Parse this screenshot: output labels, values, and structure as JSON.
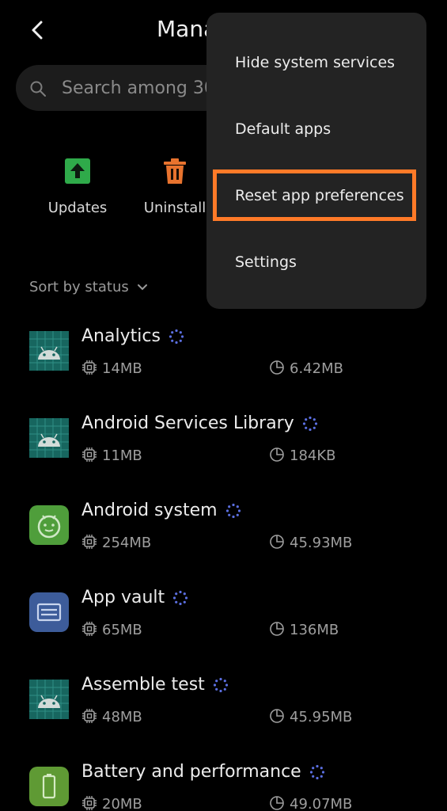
{
  "header": {
    "title": "Mana",
    "back_icon": "chevron-left-icon"
  },
  "search": {
    "placeholder": "Search among 30",
    "icon": "search-icon"
  },
  "quick_actions": [
    {
      "label": "Updates",
      "icon": "upload-arrow-icon",
      "color": "#2faa4a"
    },
    {
      "label": "Uninstall",
      "icon": "trash-icon",
      "color": "#e8732e"
    }
  ],
  "sort": {
    "label": "Sort by status",
    "icon": "chevron-down-icon"
  },
  "apps": [
    {
      "name": "Analytics",
      "size": "14MB",
      "data": "6.42MB",
      "icon": "android-robot-icon"
    },
    {
      "name": "Android Services Library",
      "size": "11MB",
      "data": "184KB",
      "icon": "android-robot-icon"
    },
    {
      "name": "Android system",
      "size": "254MB",
      "data": "45.93MB",
      "icon": "android-system-icon"
    },
    {
      "name": "App vault",
      "size": "65MB",
      "data": "136MB",
      "icon": "app-vault-icon"
    },
    {
      "name": "Assemble test",
      "size": "48MB",
      "data": "45.95MB",
      "icon": "android-robot-icon"
    },
    {
      "name": "Battery and performance",
      "size": "20MB",
      "data": "49.07MB",
      "icon": "battery-icon"
    }
  ],
  "menu": {
    "items": [
      {
        "label": "Hide system services"
      },
      {
        "label": "Default apps"
      },
      {
        "label": "Reset app preferences",
        "highlighted": true
      },
      {
        "label": "Settings"
      }
    ],
    "highlight_color": "#ff7a28"
  }
}
